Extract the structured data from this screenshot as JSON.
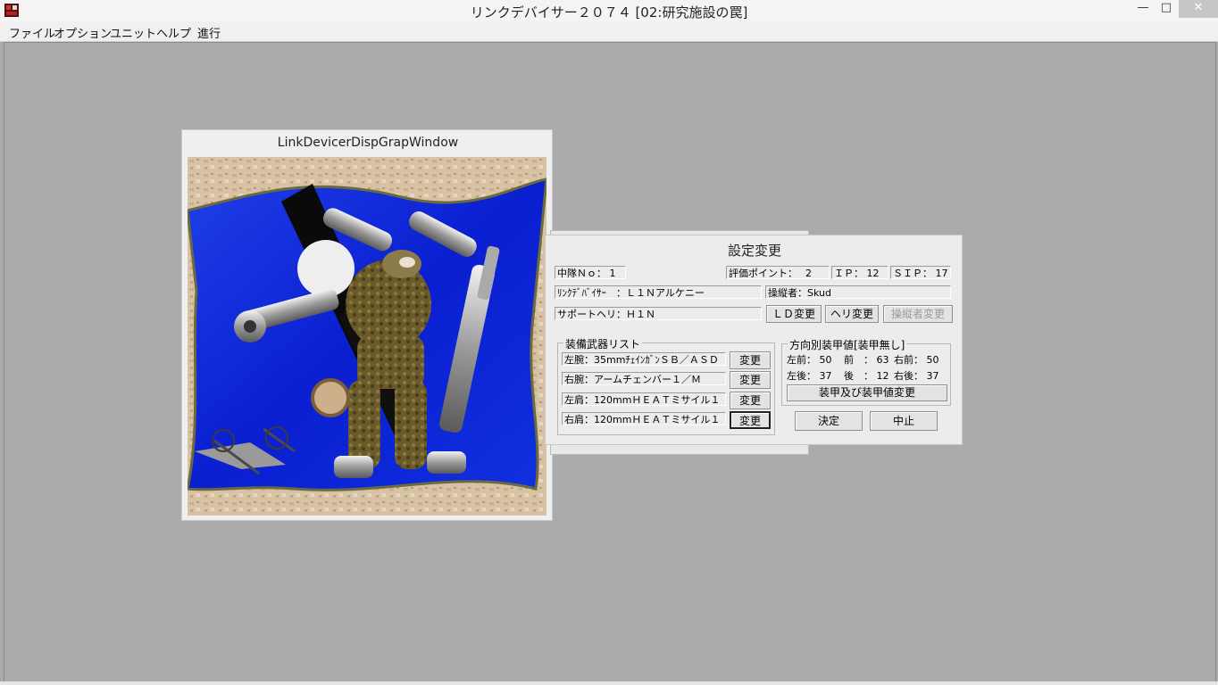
{
  "window": {
    "title": "リンクデバイサー２０７４ [02:研究施設の罠]",
    "min_glyph": "—",
    "max_glyph": "□",
    "close_glyph": "✕"
  },
  "menu": [
    "ファイル",
    "オプション",
    "ユニット",
    "ヘルプ",
    "進行"
  ],
  "graphic_window": {
    "title": "LinkDevicerDispGrapWindow"
  },
  "dialog": {
    "title": "設定変更",
    "squad_no": "中隊Ｎｏ： 1",
    "eval_points": "評価ポイント：　 2",
    "ip": "ＩＰ： 12",
    "sip": "ＳＩＰ： 17",
    "link_device": "ﾘﾝｸﾃﾞﾊﾞｲｻｰ　：Ｌ１Ｎアルケニー",
    "pilot": "操縦者：Skud",
    "support_heli": "サポートヘリ：Ｈ１Ｎ",
    "buttons": {
      "ld_change": "ＬＤ変更",
      "heli_change": "ヘリ変更",
      "pilot_change": "操縦者変更",
      "ok": "決定",
      "cancel": "中止"
    },
    "weapons": {
      "label": "装備武器リスト",
      "items": [
        {
          "text": "左腕：35mmﾁｪｲﾝｶﾞﾝＳＢ／ＡＳＤ",
          "button": "変更"
        },
        {
          "text": "右腕：アームチェンバー１／Ｍ",
          "button": "変更"
        },
        {
          "text": "左肩：120mmＨＥＡＴミサイル１",
          "button": "変更"
        },
        {
          "text": "右肩：120mmＨＥＡＴミサイル１",
          "button": "変更"
        }
      ]
    },
    "armor": {
      "label": "方向別装甲値[装甲無し]",
      "left_front": "左前： 50",
      "front": "前　： 63",
      "right_front": "右前： 50",
      "left_rear": "左後： 37",
      "rear": "後　： 12",
      "right_rear": "右後： 37",
      "button": "装甲及び装甲値変更"
    }
  }
}
